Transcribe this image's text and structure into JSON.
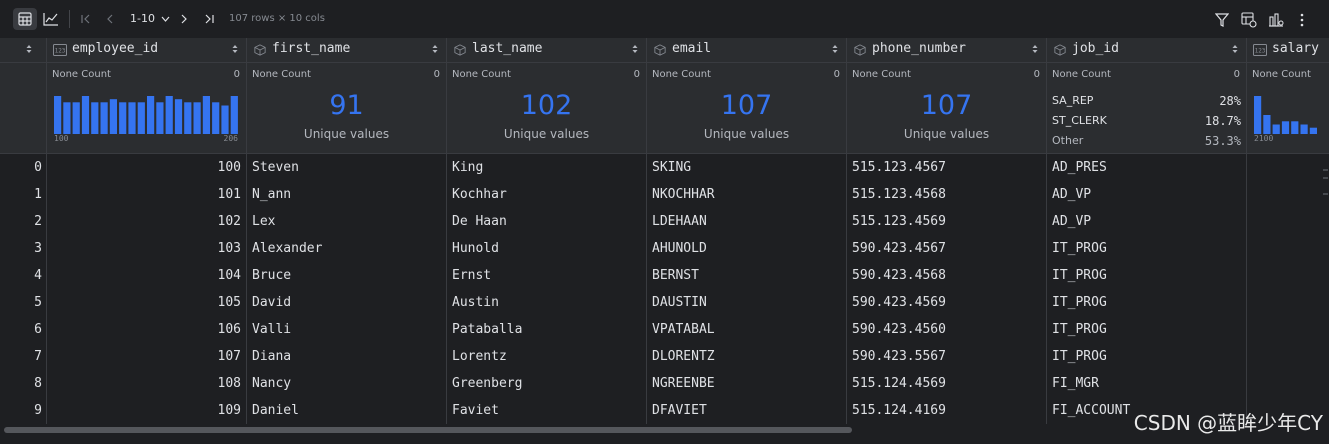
{
  "toolbar": {
    "page_range": "1-10",
    "dims": "107 rows × 10 cols"
  },
  "columns": [
    {
      "name": "employee_id",
      "type": "numeric",
      "none_count_label": "None Count",
      "none_count": "0",
      "histogram": {
        "values": [
          12,
          10,
          10,
          12,
          10,
          10,
          11,
          10,
          10,
          10,
          12,
          10,
          12,
          11,
          10,
          10,
          12,
          10,
          9,
          12
        ],
        "min_label": "100",
        "max_label": "206"
      },
      "cells": [
        "100",
        "101",
        "102",
        "103",
        "104",
        "105",
        "106",
        "107",
        "108",
        "109"
      ]
    },
    {
      "name": "first_name",
      "type": "text",
      "none_count_label": "None Count",
      "none_count": "0",
      "unique": "91",
      "unique_label": "Unique values",
      "cells": [
        "Steven",
        "N_ann",
        "Lex",
        "Alexander",
        "Bruce",
        "David",
        "Valli",
        "Diana",
        "Nancy",
        "Daniel"
      ]
    },
    {
      "name": "last_name",
      "type": "text",
      "none_count_label": "None Count",
      "none_count": "0",
      "unique": "102",
      "unique_label": "Unique values",
      "cells": [
        "King",
        "Kochhar",
        "De Haan",
        "Hunold",
        "Ernst",
        "Austin",
        "Pataballa",
        "Lorentz",
        "Greenberg",
        "Faviet"
      ]
    },
    {
      "name": "email",
      "type": "text",
      "none_count_label": "None Count",
      "none_count": "0",
      "unique": "107",
      "unique_label": "Unique values",
      "cells": [
        "SKING",
        "NKOCHHAR",
        "LDEHAAN",
        "AHUNOLD",
        "BERNST",
        "DAUSTIN",
        "VPATABAL",
        "DLORENTZ",
        "NGREENBE",
        "DFAVIET"
      ]
    },
    {
      "name": "phone_number",
      "type": "text",
      "none_count_label": "None Count",
      "none_count": "0",
      "unique": "107",
      "unique_label": "Unique values",
      "cells": [
        "515.123.4567",
        "515.123.4568",
        "515.123.4569",
        "590.423.4567",
        "590.423.4568",
        "590.423.4569",
        "590.423.4560",
        "590.423.5567",
        "515.124.4569",
        "515.124.4169"
      ]
    },
    {
      "name": "job_id",
      "type": "text",
      "none_count_label": "None Count",
      "none_count": "0",
      "categories": [
        {
          "label": "SA_REP",
          "pct": "28%"
        },
        {
          "label": "ST_CLERK",
          "pct": "18.7%"
        },
        {
          "label": "Other",
          "pct": "53.3%"
        }
      ],
      "cells": [
        "AD_PRES",
        "AD_VP",
        "AD_VP",
        "IT_PROG",
        "IT_PROG",
        "IT_PROG",
        "IT_PROG",
        "IT_PROG",
        "FI_MGR",
        "FI_ACCOUNT"
      ]
    },
    {
      "name": "salary",
      "type": "numeric",
      "none_count_label": "None Count",
      "none_count": "",
      "histogram": {
        "values": [
          12,
          6,
          3,
          4,
          4,
          3,
          2
        ],
        "min_label": "2100",
        "max_label": ""
      },
      "cells": [
        "",
        "",
        "",
        "",
        "",
        "",
        "",
        "",
        "",
        ""
      ]
    }
  ],
  "row_index": [
    "0",
    "1",
    "2",
    "3",
    "4",
    "5",
    "6",
    "7",
    "8",
    "9"
  ],
  "watermark": "CSDN @蓝眸少年CY",
  "colors": {
    "accent": "#3574f0",
    "bg": "#1e1f22",
    "header_bg": "#2b2d30"
  }
}
